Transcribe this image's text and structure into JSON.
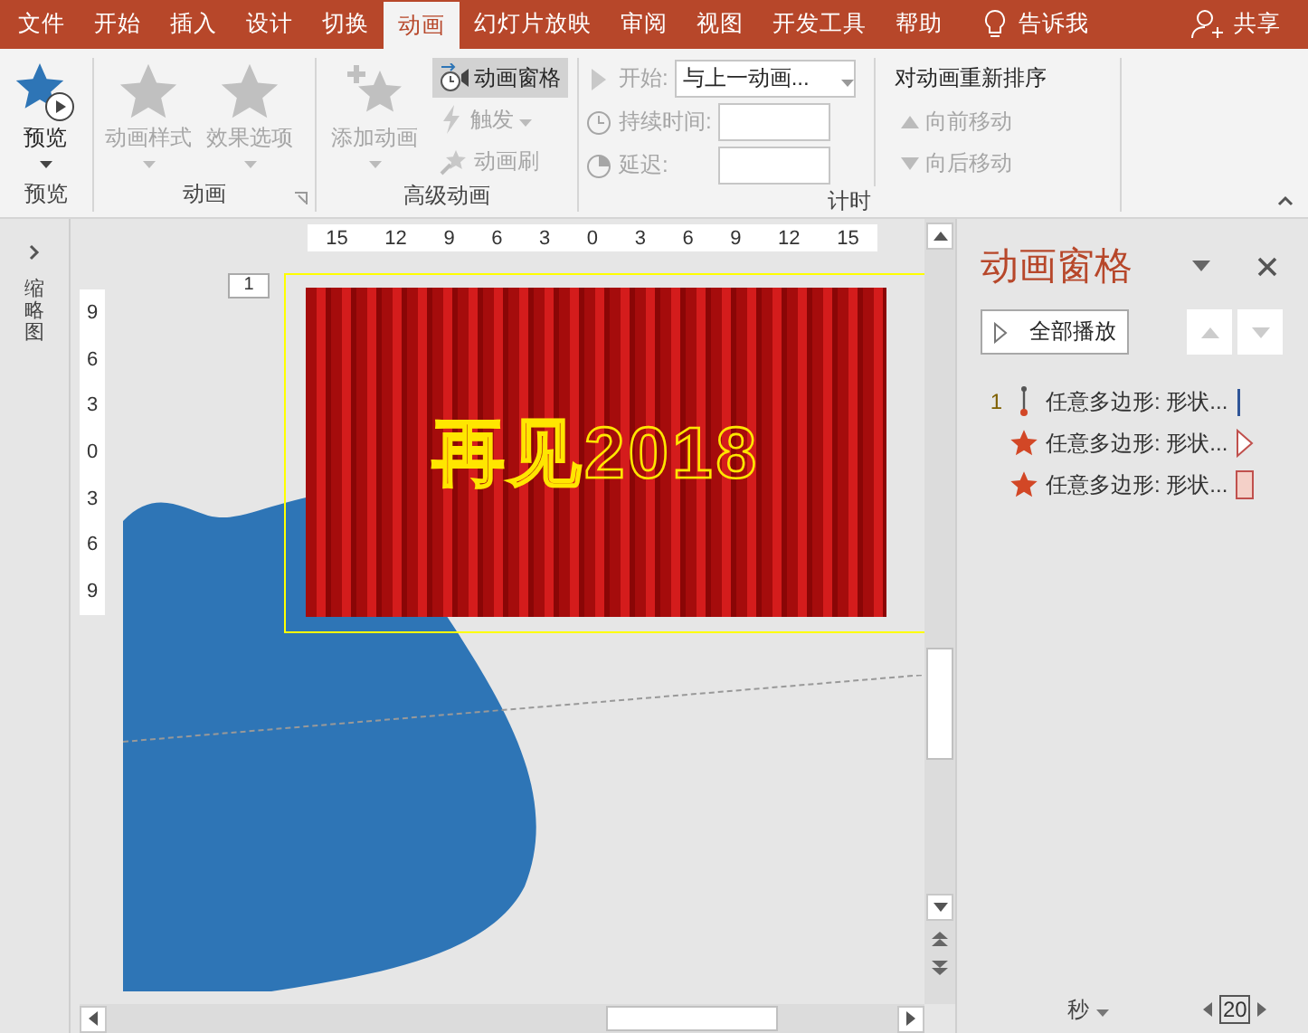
{
  "menu_tabs": [
    {
      "label": "文件",
      "selected": false
    },
    {
      "label": "开始",
      "selected": false
    },
    {
      "label": "插入",
      "selected": false
    },
    {
      "label": "设计",
      "selected": false
    },
    {
      "label": "切换",
      "selected": false
    },
    {
      "label": "动画",
      "selected": true
    },
    {
      "label": "幻灯片放映",
      "selected": false
    },
    {
      "label": "审阅",
      "selected": false
    },
    {
      "label": "视图",
      "selected": false
    },
    {
      "label": "开发工具",
      "selected": false
    },
    {
      "label": "帮助",
      "selected": false
    }
  ],
  "tell_me": "告诉我",
  "share": "共享",
  "preview_group": {
    "button": "预览",
    "label": "预览"
  },
  "animation_group": {
    "label": "动画",
    "buttons": [
      {
        "label": "动画样式",
        "disabled": true
      },
      {
        "label": "效果选项",
        "disabled": true
      }
    ]
  },
  "advanced_group": {
    "label": "高级动画",
    "add": {
      "label": "添加动画",
      "disabled": true
    },
    "small_buttons": [
      {
        "label": "动画窗格",
        "kind": "pane",
        "disabled": false,
        "selected": true
      },
      {
        "label": "触发",
        "kind": "trigger",
        "disabled": true,
        "selected": false
      },
      {
        "label": "动画刷",
        "kind": "painter",
        "disabled": true,
        "selected": false
      }
    ]
  },
  "timing_group": {
    "label": "计时",
    "disabled": true,
    "start": {
      "label": "开始:",
      "value": "与上一动画..."
    },
    "duration": {
      "label": "持续时间:"
    },
    "delay": {
      "label": "延迟:"
    },
    "reorder": {
      "title": "对动画重新排序",
      "buttons": [
        {
          "label": "向前移动",
          "kind": "up",
          "disabled": true
        },
        {
          "label": "向后移动",
          "kind": "down",
          "disabled": true
        }
      ]
    }
  },
  "thumbnail_pane": {
    "label": "缩略图"
  },
  "editor": {
    "ruler_h": [
      "15",
      "12",
      "9",
      "6",
      "3",
      "0",
      "3",
      "6",
      "9",
      "12",
      "15"
    ],
    "ruler_v": [
      "9",
      "6",
      "3",
      "0",
      "3",
      "6",
      "9"
    ],
    "slide_number": "1",
    "slide_text": "再见2018"
  },
  "animation_pane": {
    "title": "动画窗格",
    "play_all": "全部播放",
    "items": [
      {
        "order": "1",
        "label": "任意多边形: 形状...",
        "kind": "path"
      },
      {
        "label": "任意多边形: 形状...",
        "kind": "arrow"
      },
      {
        "label": "任意多边形: 形状...",
        "kind": "block"
      }
    ],
    "timeline": {
      "unit": "秒",
      "value": "20"
    }
  }
}
